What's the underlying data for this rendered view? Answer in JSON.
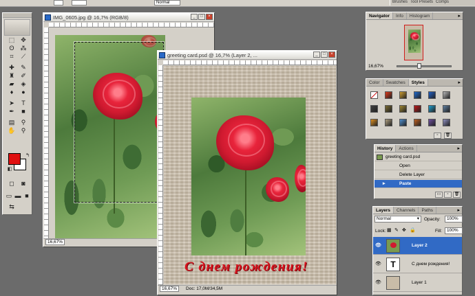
{
  "documents": {
    "photo": {
      "title": "IMG_0605.jpg @ 16,7% (RGB/8)",
      "zoom": "16,67%"
    },
    "card": {
      "title": "greeting card.psd @ 16,7% (Layer 2, ...",
      "zoom": "16,67%",
      "doc_size": "Doc: 17,0M/34,5M",
      "greeting_text": "С днем рождения!"
    }
  },
  "palette_well": {
    "tabs": [
      "Brushes",
      "Tool Presets",
      "Comps"
    ]
  },
  "navigator_panel": {
    "tabs": [
      "Navigator",
      "Info",
      "Histogram"
    ],
    "active_tab": "Navigator",
    "zoom": "16,67%"
  },
  "styles_panel": {
    "tabs": [
      "Color",
      "Swatches",
      "Styles"
    ],
    "active_tab": "Styles",
    "swatches": [
      "#ffffff",
      "#e03a1a",
      "#d0a030",
      "#1d6ad0",
      "#2060c8",
      "#b8b8b8",
      "#404040",
      "#7a6a30",
      "#a08830",
      "#c01818",
      "#20a0d0",
      "#6080a0",
      "#e09020",
      "#b0a080",
      "#5090d0",
      "#c06020",
      "#7050a0",
      "#9090c0"
    ]
  },
  "history_panel": {
    "tabs": [
      "History",
      "Actions"
    ],
    "active_tab": "History",
    "snapshot": "greeting card.psd",
    "steps": [
      "Open",
      "Delete Layer",
      "Paste"
    ],
    "selected_step": "Paste"
  },
  "layers_panel": {
    "tabs": [
      "Layers",
      "Channels",
      "Paths"
    ],
    "active_tab": "Layers",
    "blend_mode": "Normal",
    "opacity_label": "Opacity:",
    "opacity": "100%",
    "lock_label": "Lock:",
    "fill_label": "Fill:",
    "fill": "100%",
    "layers": [
      {
        "name": "Layer 2",
        "thumb": "rose",
        "selected": true
      },
      {
        "name": "С днем рождения!",
        "thumb": "T",
        "selected": false
      },
      {
        "name": "Layer 1",
        "thumb": "texture",
        "selected": false
      }
    ]
  },
  "toolbox": {
    "foreground_color": "#e01010",
    "background_color": "#ffffff"
  },
  "options_bar": {
    "mode": "Normal"
  }
}
